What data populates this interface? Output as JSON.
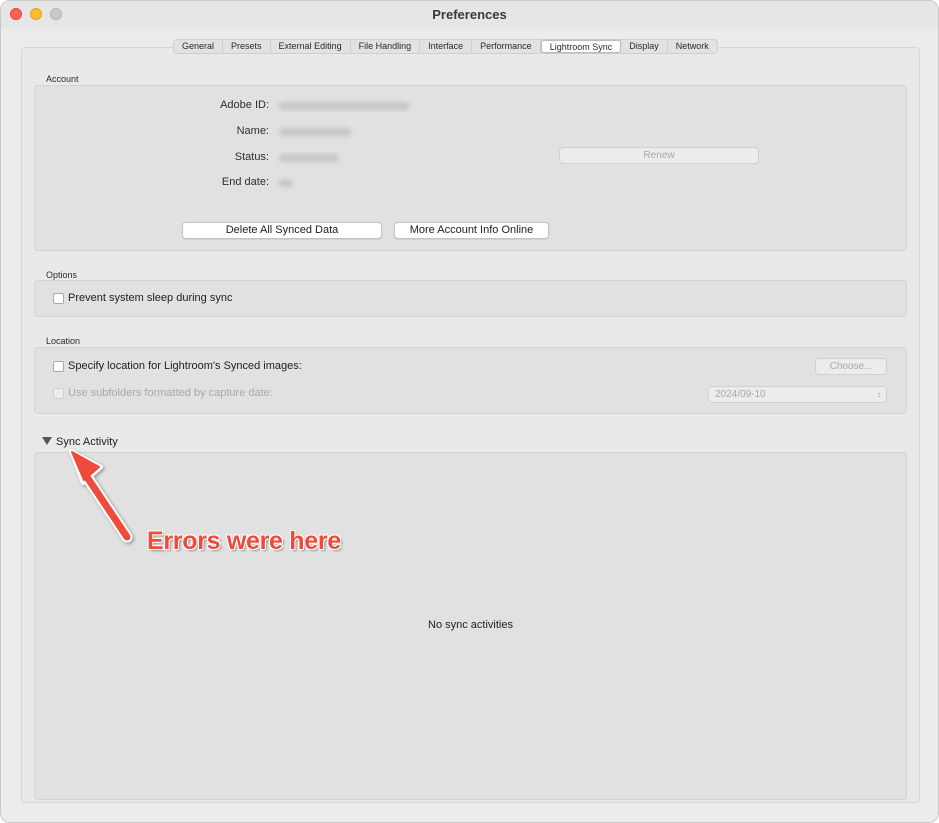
{
  "window": {
    "title": "Preferences"
  },
  "tabs": [
    {
      "label": "General",
      "active": false
    },
    {
      "label": "Presets",
      "active": false
    },
    {
      "label": "External Editing",
      "active": false
    },
    {
      "label": "File Handling",
      "active": false
    },
    {
      "label": "Interface",
      "active": false
    },
    {
      "label": "Performance",
      "active": false
    },
    {
      "label": "Lightroom Sync",
      "active": true
    },
    {
      "label": "Display",
      "active": false
    },
    {
      "label": "Network",
      "active": false
    }
  ],
  "account": {
    "section_label": "Account",
    "adobe_id_label": "Adobe ID:",
    "name_label": "Name:",
    "status_label": "Status:",
    "end_date_label": "End date:",
    "renew_button": "Renew",
    "delete_button": "Delete All Synced Data",
    "more_info_button": "More Account Info Online"
  },
  "options": {
    "section_label": "Options",
    "prevent_sleep_label": "Prevent system sleep during sync",
    "prevent_sleep_checked": false
  },
  "location": {
    "section_label": "Location",
    "specify_label": "Specify location for Lightroom's Synced images:",
    "specify_checked": false,
    "choose_button": "Choose...",
    "subfolders_label": "Use subfolders formatted by capture date:",
    "subfolders_checked": false,
    "date_format_value": "2024/09-10"
  },
  "sync_activity": {
    "title": "Sync Activity",
    "empty_message": "No sync activities"
  },
  "annotation": {
    "text": "Errors were here",
    "color": "#ee4b3c"
  }
}
